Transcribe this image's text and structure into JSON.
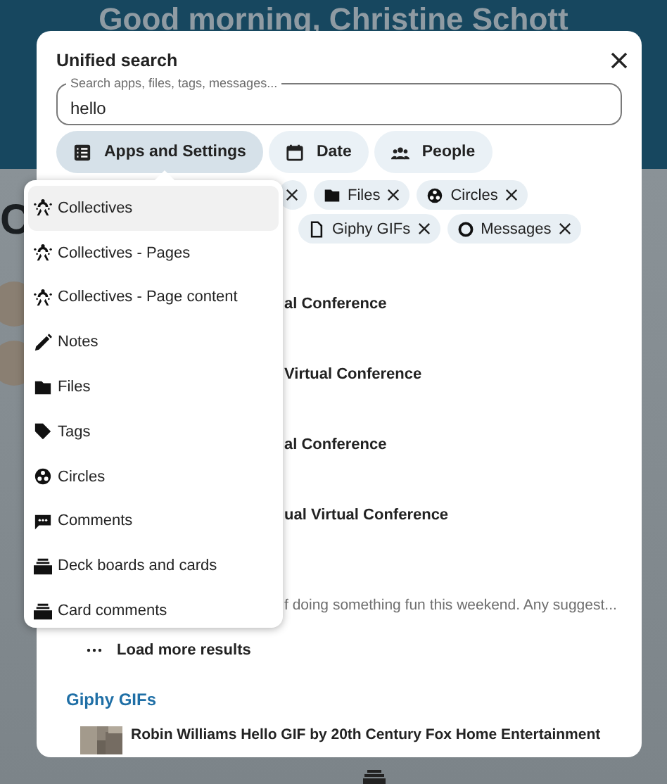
{
  "background": {
    "greeting": "Good morning, Christine Schott",
    "heading_fragment": "C"
  },
  "dialog": {
    "title": "Unified search",
    "search": {
      "placeholder": "Search apps, files, tags, messages...",
      "value": "hello"
    },
    "filters": [
      {
        "label": "Apps and Settings",
        "kind": "apps",
        "selected": true
      },
      {
        "label": "Date",
        "kind": "calendar",
        "selected": false
      },
      {
        "label": "People",
        "kind": "people",
        "selected": false
      }
    ],
    "chip_rows": [
      [
        {
          "kind": "partial"
        },
        {
          "kind": "folder",
          "label": "Files"
        },
        {
          "kind": "circles",
          "label": "Circles"
        }
      ],
      [
        {
          "kind": "file",
          "label": "Giphy GIFs"
        },
        {
          "kind": "message",
          "label": "Messages"
        }
      ]
    ],
    "results": [
      {
        "title": "al Conference"
      },
      {
        "title": "Virtual Conference"
      },
      {
        "title": "al Conference"
      },
      {
        "title": "ual Virtual Conference"
      },
      {
        "subtitle": "f doing something fun this weekend. Any suggest..."
      }
    ],
    "load_more": "Load more results",
    "sections": [
      {
        "title": "Giphy GIFs",
        "results": [
          {
            "title": "Robin Williams Hello GIF by 20th Century Fox Home Entertainment"
          }
        ]
      }
    ]
  },
  "dropdown": {
    "items": [
      {
        "label": "Collectives",
        "kind": "collectives",
        "selected": true
      },
      {
        "label": "Collectives - Pages",
        "kind": "collectives",
        "selected": false
      },
      {
        "label": "Collectives - Page content",
        "kind": "collectives",
        "selected": false
      },
      {
        "label": "Notes",
        "kind": "pencil",
        "selected": false
      },
      {
        "label": "Files",
        "kind": "folder",
        "selected": false
      },
      {
        "label": "Tags",
        "kind": "tag",
        "selected": false
      },
      {
        "label": "Circles",
        "kind": "circles",
        "selected": false
      },
      {
        "label": "Comments",
        "kind": "comment",
        "selected": false
      },
      {
        "label": "Deck boards and cards",
        "kind": "deck",
        "selected": false
      },
      {
        "label": "Card comments",
        "kind": "deck",
        "selected": false
      }
    ]
  }
}
